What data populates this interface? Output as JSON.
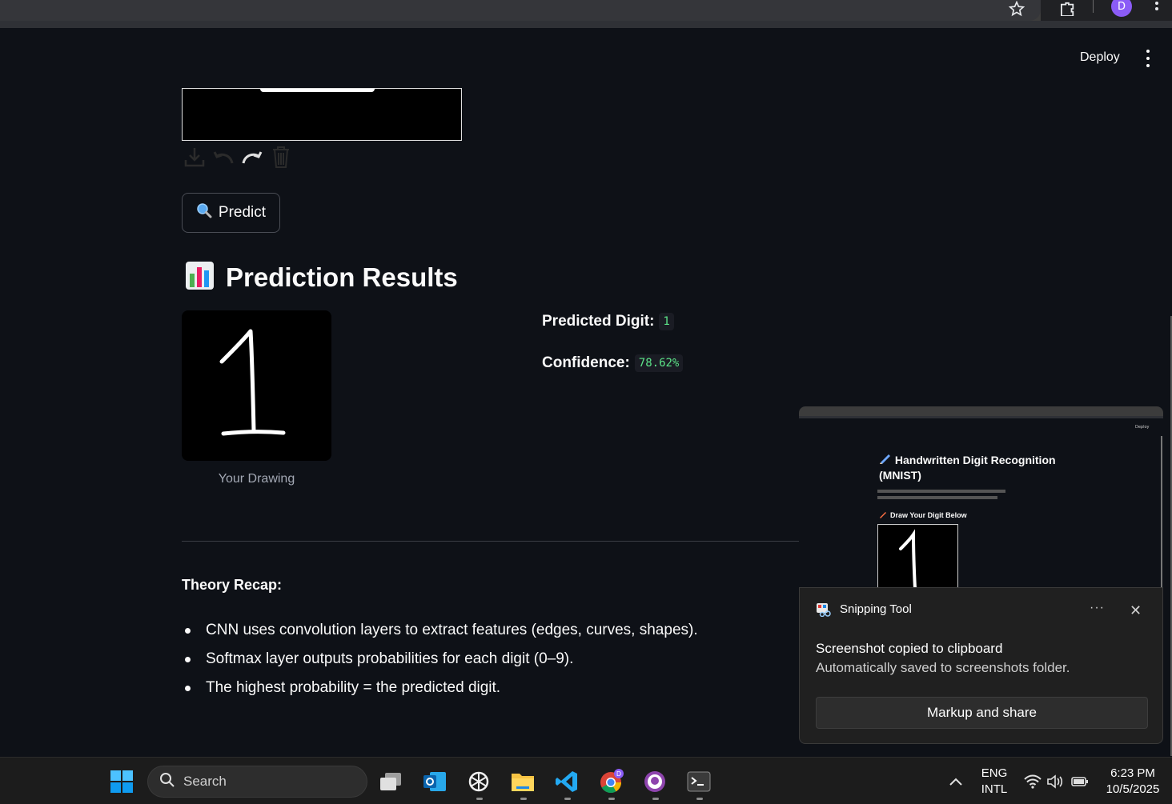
{
  "browser": {
    "profile_initial": "D"
  },
  "header": {
    "deploy_label": "Deploy"
  },
  "predict_button": {
    "icon": "magnifier-icon",
    "label": "Predict"
  },
  "results": {
    "title": "Prediction Results",
    "title_icon": "bar-chart-icon",
    "drawing_caption": "Your Drawing",
    "drawn_digit": "1",
    "predicted_digit_label": "Predicted Digit:",
    "predicted_digit_value": "1",
    "confidence_label": "Confidence:",
    "confidence_value": "78.62%"
  },
  "theory": {
    "title": "Theory Recap:",
    "items": [
      "CNN uses convolution layers to extract features (edges, curves, shapes).",
      "Softmax layer outputs probabilities for each digit (0–9).",
      "The highest probability = the predicted digit."
    ]
  },
  "preview": {
    "deploy_label": "Deploy",
    "title": "Handwritten Digit Recognition (MNIST)",
    "subtitle": "Draw Your Digit Below"
  },
  "notification": {
    "app_name": "Snipping Tool",
    "heading": "Screenshot copied to clipboard",
    "body": "Automatically saved to screenshots folder.",
    "action_label": "Markup and share",
    "more_label": "···",
    "close_label": "✕"
  },
  "taskbar": {
    "search_placeholder": "Search",
    "language_line1": "ENG",
    "language_line2": "INTL",
    "time": "6:23 PM",
    "date": "10/5/2025",
    "badge_initial": "D"
  },
  "colors": {
    "background": "#0e1117",
    "accent_green": "#5ce488",
    "avatar_purple": "#8b5cf6"
  }
}
